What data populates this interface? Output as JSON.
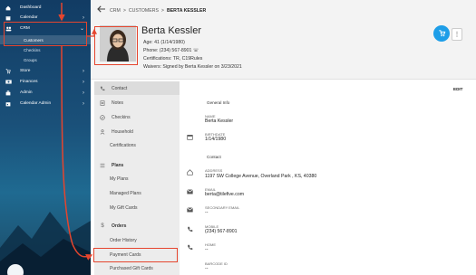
{
  "sidebar": {
    "items": [
      {
        "label": "Dashboard",
        "icon": "home-icon",
        "chevron": false
      },
      {
        "label": "Calendar",
        "icon": "calendar-icon",
        "chevron": true
      },
      {
        "label": "CRM",
        "icon": "people-icon",
        "chevron": true
      },
      {
        "label": "Store",
        "icon": "cart-icon",
        "chevron": true
      },
      {
        "label": "Finances",
        "icon": "money-icon",
        "chevron": true
      },
      {
        "label": "Admin",
        "icon": "briefcase-icon",
        "chevron": true
      },
      {
        "label": "Calendar Admin",
        "icon": "calendar-admin-icon",
        "chevron": true
      }
    ],
    "crm_sub": [
      {
        "label": "Customers",
        "active": true
      },
      {
        "label": "Checkins",
        "active": false
      },
      {
        "label": "Groups",
        "active": false
      }
    ]
  },
  "header": {
    "breadcrumbs": [
      "CRM",
      ">",
      "CUSTOMERS",
      ">",
      "BERTA KESSLER"
    ],
    "name": "Berta Kessler",
    "age_line": "Age: 41 (1/14/1980)",
    "phone_line": "Phone: (234) 567-8901",
    "certs_line": "Certifications: TR, C19Rules",
    "waivers_line": "Waivers: Signed by Berta Kessler on 3/23/2021"
  },
  "subnav": [
    {
      "label": "Contact",
      "icon": "phone-icon",
      "type": "top",
      "active": true
    },
    {
      "label": "Notes",
      "icon": "notes-icon",
      "type": "top"
    },
    {
      "label": "Checkins",
      "icon": "check-circle-icon",
      "type": "top"
    },
    {
      "label": "Household",
      "icon": "person-icon",
      "type": "top"
    },
    {
      "label": "Certifications",
      "icon": "",
      "type": "child"
    },
    {
      "label": "Plans",
      "icon": "list-icon",
      "type": "section"
    },
    {
      "label": "My Plans",
      "icon": "",
      "type": "child"
    },
    {
      "label": "Managed Plans",
      "icon": "",
      "type": "child"
    },
    {
      "label": "My Gift Cards",
      "icon": "",
      "type": "child"
    },
    {
      "label": "Orders",
      "icon": "dollar-icon",
      "type": "section"
    },
    {
      "label": "Order History",
      "icon": "",
      "type": "child"
    },
    {
      "label": "Payment Cards",
      "icon": "",
      "type": "child"
    },
    {
      "label": "Purchased Gift Cards",
      "icon": "",
      "type": "child"
    }
  ],
  "content": {
    "edit_label": "EDIT",
    "general_info_title": "General Info",
    "name_label": "NAME",
    "name_value": "Berta Kessler",
    "birthdate_label": "BIRTHDATE",
    "birthdate_value": "1/14/1980",
    "contact_title": "Contact",
    "address_label": "ADDRESS",
    "address_value": "1197 SW College Avenue, Overland Park , KS, 40380",
    "email_label": "EMAIL",
    "email_value": "berta@tilefive.com",
    "secondary_email_label": "SECONDARY EMAIL",
    "secondary_email_value": "--",
    "mobile_label": "MOBILE",
    "mobile_value": "(234) 567-8901",
    "home_label": "HOME",
    "home_value": "--",
    "barcode_label": "BARCODE ID",
    "barcode_value": "--"
  },
  "colors": {
    "annotation": "#e5452e",
    "accent_blue": "#1e9ee8",
    "sidebar_top": "#123c64"
  }
}
